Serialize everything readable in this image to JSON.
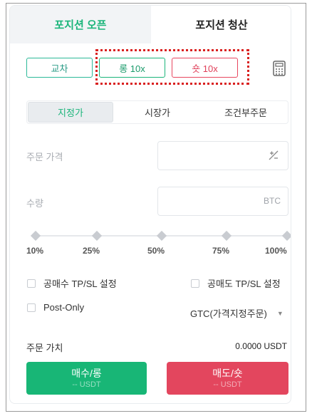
{
  "tabs": {
    "open": "포지션 오픈",
    "close": "포지션 청산"
  },
  "mode": {
    "cross": "교차",
    "long_leverage": "롱 10x",
    "short_leverage": "숏 10x"
  },
  "order_types": {
    "limit": "지정가",
    "market": "시장가",
    "conditional": "조건부주문"
  },
  "price": {
    "label": "주문 가격",
    "value": ""
  },
  "quantity": {
    "label": "수량",
    "value": "",
    "unit": "BTC"
  },
  "slider": {
    "labels": [
      "10%",
      "25%",
      "50%",
      "75%",
      "100%"
    ]
  },
  "options": {
    "long_tpsl": "공매수 TP/SL 설정",
    "short_tpsl": "공매도 TP/SL 설정",
    "post_only": "Post-Only",
    "time_in_force": "GTC(가격지정주문)"
  },
  "order_value": {
    "label": "주문 가치",
    "value": "0.0000 USDT"
  },
  "buttons": {
    "buy_main": "매수/롱",
    "buy_sub": "-- USDT",
    "sell_main": "매도/숏",
    "sell_sub": "-- USDT"
  },
  "colors": {
    "green": "#18b676",
    "red": "#e3465e",
    "highlight": "#d9201f"
  },
  "icons": {
    "calculator": "calculator-icon",
    "plus_minus": "plus-minus-icon",
    "dropdown": "caret-down-icon"
  }
}
